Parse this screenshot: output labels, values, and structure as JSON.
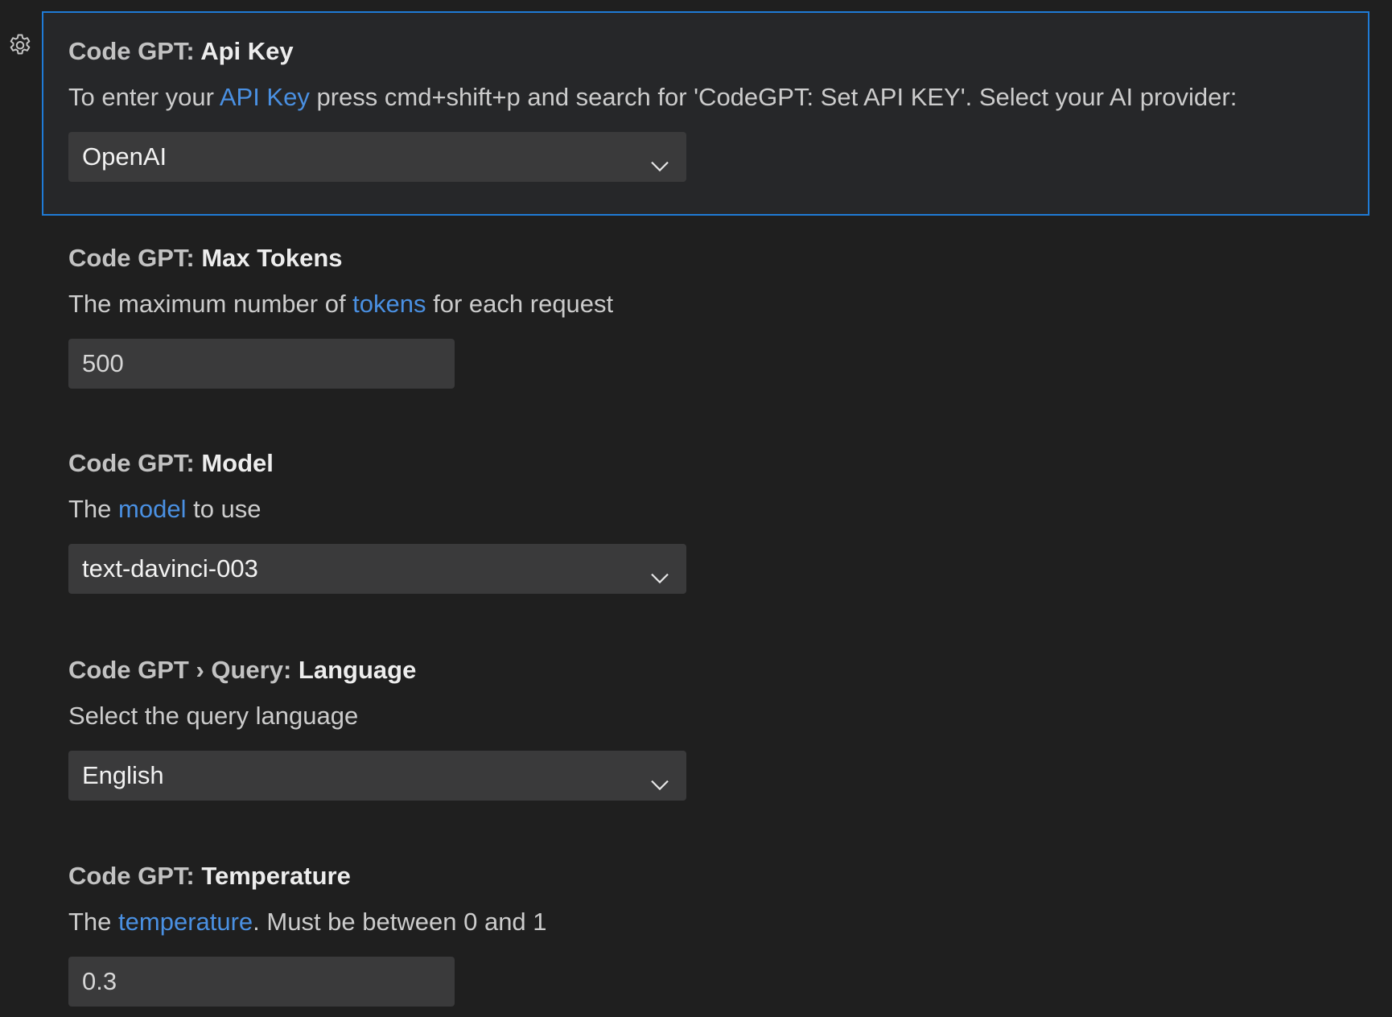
{
  "settings": [
    {
      "prefix": "Code GPT: ",
      "key": "Api Key",
      "desc_before": "To enter your ",
      "desc_link": "API Key",
      "desc_after": " press cmd+shift+p and search for 'CodeGPT: Set API KEY'. Select your AI provider:",
      "control": "dropdown",
      "value": "OpenAI"
    },
    {
      "prefix": "Code GPT: ",
      "key": "Max Tokens",
      "desc_before": "The maximum number of ",
      "desc_link": "tokens",
      "desc_after": " for each request",
      "control": "textbox",
      "value": "500"
    },
    {
      "prefix": "Code GPT: ",
      "key": "Model",
      "desc_before": "The ",
      "desc_link": "model",
      "desc_after": " to use",
      "control": "dropdown",
      "value": "text-davinci-003"
    },
    {
      "prefix": "Code GPT › Query: ",
      "key": "Language",
      "desc_before": "Select the query language",
      "desc_link": "",
      "desc_after": "",
      "control": "dropdown",
      "value": "English"
    },
    {
      "prefix": "Code GPT: ",
      "key": "Temperature",
      "desc_before": "The ",
      "desc_link": "temperature",
      "desc_after": ". Must be between 0 and 1",
      "control": "textbox",
      "value": "0.3"
    }
  ],
  "icons": {
    "gear": "gear-icon",
    "chevron": "chevron-down-icon"
  },
  "colors": {
    "background": "#1f1f1f",
    "focus_border": "#1f7bd6",
    "link": "#4a90e2",
    "input_bg": "#3a3a3b"
  }
}
